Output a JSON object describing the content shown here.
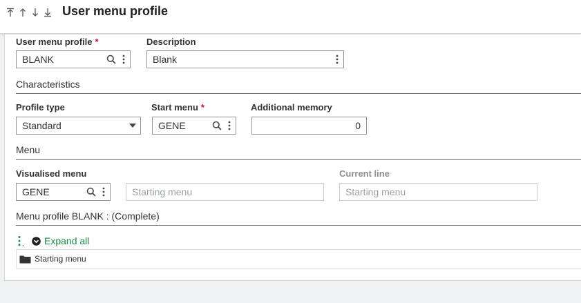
{
  "header": {
    "title": "User menu profile",
    "nav_icons": [
      "arrow-first-icon",
      "arrow-up-icon",
      "arrow-down-icon",
      "arrow-last-icon"
    ]
  },
  "fields": {
    "user_menu_profile": {
      "label": "User menu profile",
      "required": "*",
      "value": "BLANK"
    },
    "description": {
      "label": "Description",
      "value": "Blank"
    }
  },
  "characteristics": {
    "title": "Characteristics",
    "profile_type": {
      "label": "Profile type",
      "value": "Standard"
    },
    "start_menu": {
      "label": "Start menu",
      "required": "*",
      "value": "GENE"
    },
    "additional_memory": {
      "label": "Additional memory",
      "value": "0"
    }
  },
  "menu": {
    "title": "Menu",
    "visualised_menu": {
      "label": "Visualised menu",
      "value": "GENE",
      "description": "Starting menu"
    },
    "current_line": {
      "label": "Current line",
      "value": "Starting menu"
    }
  },
  "tree": {
    "title": "Menu profile BLANK : (Complete)",
    "expand_all": "Expand all",
    "items": [
      {
        "label": "Starting menu",
        "icon": "folder-icon"
      }
    ]
  },
  "colors": {
    "accent_green": "#1a8b47",
    "required_red": "#c8102e"
  }
}
